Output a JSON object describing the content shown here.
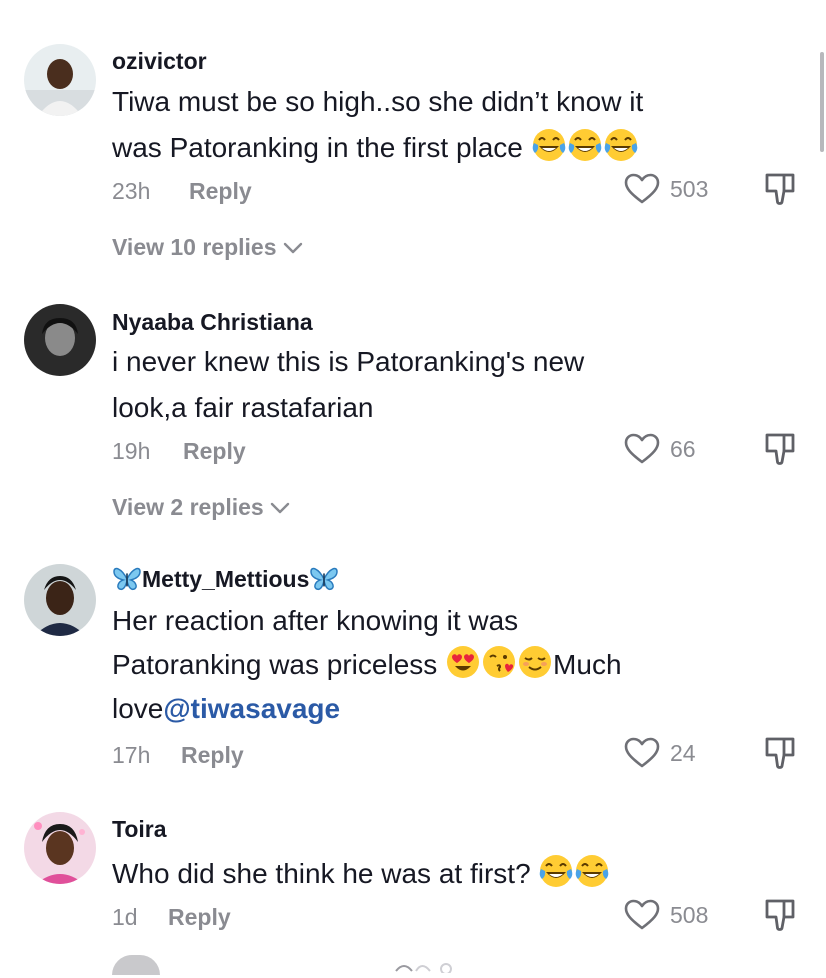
{
  "comments": [
    {
      "username": "ozivictor",
      "text_lines": [
        "Tiwa must be so high..so she didn’t know it",
        "was Patoranking in the first place"
      ],
      "emojis": [
        "joy",
        "joy",
        "joy"
      ],
      "time": "23h",
      "reply_label": "Reply",
      "likes": "503",
      "view_replies": "View 10 replies"
    },
    {
      "username": "Nyaaba Christiana",
      "text_lines": [
        "i never knew this is Patoranking's new",
        "look,a fair rastafarian"
      ],
      "time": "19h",
      "reply_label": "Reply",
      "likes": "66",
      "view_replies": "View 2 replies"
    },
    {
      "username": "Metty_Mettious",
      "text_line1": "Her reaction after knowing it was",
      "text_line2_pre": "Patoranking was priceless ",
      "text_line2_post": "Much",
      "text_line3_pre": "love",
      "mention": "@tiwasavage",
      "emojis": [
        "heart-eyes",
        "kissing-heart",
        "smiling"
      ],
      "time": "17h",
      "reply_label": "Reply",
      "likes": "24"
    },
    {
      "username": "Toira",
      "text": "Who did she think he was at first?",
      "emojis": [
        "joy",
        "joy"
      ],
      "time": "1d",
      "reply_label": "Reply",
      "likes": "508"
    }
  ],
  "colors": {
    "text": "#161823",
    "muted": "#8a8b91",
    "mention": "#2b5aa6",
    "background": "#ffffff"
  },
  "icons": {
    "like": "heart-outline-icon",
    "dislike": "thumbs-down-icon",
    "expand": "chevron-down-icon",
    "username_decoration": "butterfly-icon"
  }
}
